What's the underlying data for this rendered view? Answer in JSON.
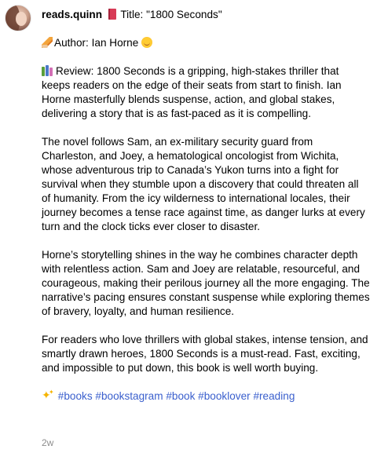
{
  "post": {
    "username": "reads.quinn",
    "title_text": "Title: \"1800 Seconds\"",
    "author_text": "Author: Ian Horne",
    "review_text": "Review: 1800 Seconds is a gripping, high-stakes thriller that keeps readers on the edge of their seats from start to finish. Ian Horne masterfully blends suspense, action, and global stakes, delivering a story that is as fast-paced as it is compelling.",
    "paragraph_2": "The novel follows Sam, an ex-military security guard from Charleston, and Joey, a hematological oncologist from Wichita, whose adventurous trip to Canada’s Yukon turns into a fight for survival when they stumble upon a discovery that could threaten all of humanity. From the icy wilderness to international locales, their journey becomes a tense race against time, as danger lurks at every turn and the clock ticks ever closer to disaster.",
    "paragraph_3": "Horne’s storytelling shines in the way he combines character depth with relentless action. Sam and Joey are relatable, resourceful, and courageous, making their perilous journey all the more engaging. The narrative’s pacing ensures constant suspense while exploring themes of bravery, loyalty, and human resilience.",
    "paragraph_4": "For readers who love thrillers with global stakes, intense tension, and smartly drawn heroes, 1800 Seconds is a must-read. Fast, exciting, and impossible to put down, this book is well worth buying.",
    "hashtags": [
      "#books",
      "#bookstagram",
      "#book",
      "#booklover",
      "#reading"
    ],
    "timestamp": "2w"
  },
  "icons": {
    "title": "closed-book-icon",
    "author": "writing-hand-icon",
    "author_suffix": "smiling-face-icon",
    "review": "books-icon",
    "tags": "sparkles-icon"
  },
  "colors": {
    "hashtag": "#3a5fcd",
    "timestamp": "#8e8e8e",
    "text": "#000000"
  }
}
